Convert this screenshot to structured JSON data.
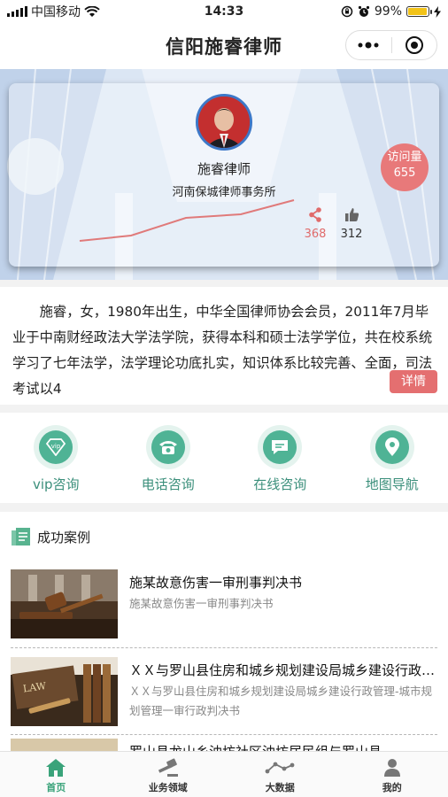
{
  "status_bar": {
    "carrier": "中国移动",
    "time": "14:33",
    "battery": "99%",
    "battery_level": 0.99
  },
  "nav": {
    "title": "信阳施睿律师"
  },
  "profile": {
    "name": "施睿律师",
    "firm": "河南保城律师事务所",
    "visits_label": "访问量",
    "visits_count": "655",
    "shares": "368",
    "likes": "312"
  },
  "intro": {
    "text": "施睿，女，1980年出生，中华全国律师协会会员，2011年7月毕业于中南财经政法大学法学院，获得本科和硕士法学学位，共在校系统学习了七年法学，法学理论功底扎实，知识体系比较完善、全面，司法考试以4",
    "detail_label": "详情"
  },
  "services": [
    {
      "label": "vip咨询",
      "icon": "vip-icon"
    },
    {
      "label": "电话咨询",
      "icon": "phone-icon"
    },
    {
      "label": "在线咨询",
      "icon": "chat-icon"
    },
    {
      "label": "地图导航",
      "icon": "location-pin-icon"
    }
  ],
  "cases": {
    "title": "成功案例",
    "items": [
      {
        "title": "施某故意伤害一审刑事判决书",
        "subtitle": "施某故意伤害一审刑事判决书"
      },
      {
        "title": "ＸＸ与罗山县住房和城乡规划建设局城乡建设行政管理",
        "subtitle": "ＸＸ与罗山县住房和城乡规划建设局城乡建设行政管理-城市规划管理一审行政判决书"
      },
      {
        "title": "罗山县龙山乡油坊社区油坊居民组与罗山县"
      }
    ]
  },
  "tabs": [
    {
      "label": "首页",
      "icon": "home-icon",
      "active": true
    },
    {
      "label": "业务领域",
      "icon": "gavel-icon",
      "active": false
    },
    {
      "label": "大数据",
      "icon": "data-chart-icon",
      "active": false
    },
    {
      "label": "我的",
      "icon": "user-icon",
      "active": false
    }
  ],
  "colors": {
    "accent": "#3aa37a",
    "service_green": "#4fb395",
    "pink": "#e46f70",
    "avatar_border": "#3d78c8"
  }
}
